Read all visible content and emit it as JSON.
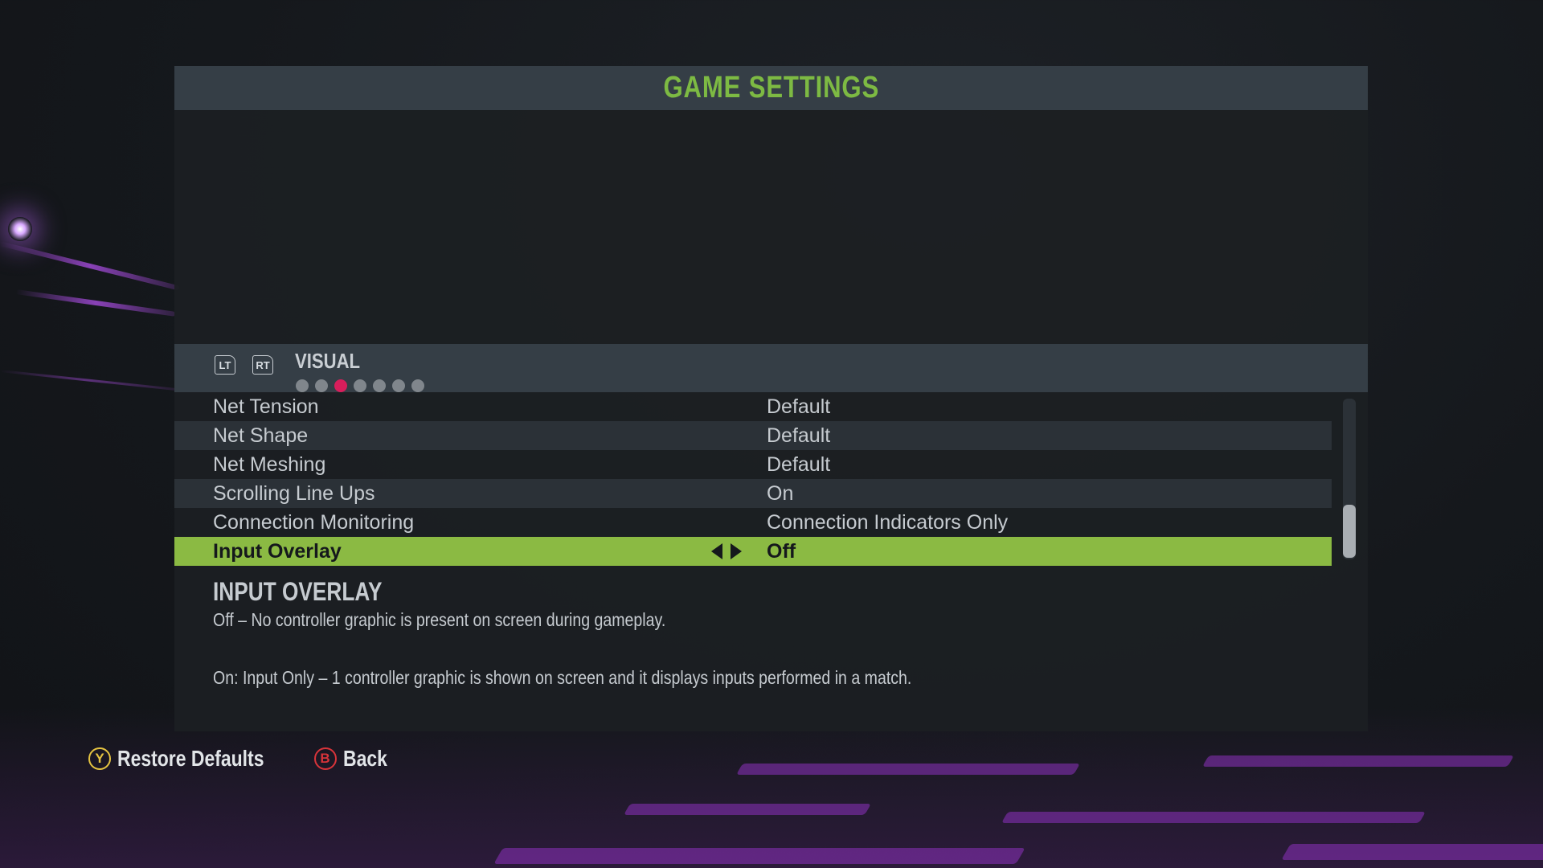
{
  "header": {
    "title": "GAME SETTINGS"
  },
  "tabs": {
    "lt_label": "LT",
    "rt_label": "RT",
    "current_tab": "VISUAL",
    "page_count": 7,
    "active_page": 3
  },
  "settings": [
    {
      "label": "Net Tension",
      "value": "Default"
    },
    {
      "label": "Net Shape",
      "value": "Default"
    },
    {
      "label": "Net Meshing",
      "value": "Default"
    },
    {
      "label": "Scrolling Line Ups",
      "value": "On"
    },
    {
      "label": "Connection Monitoring",
      "value": "Connection Indicators Only"
    },
    {
      "label": "Input Overlay",
      "value": "Off"
    }
  ],
  "description": {
    "title": "INPUT OVERLAY",
    "line1": "Off – No controller graphic is present on screen during gameplay.",
    "line2": "On: Input Only – 1 controller graphic is shown on screen and it displays inputs performed in a match."
  },
  "footer": {
    "restore_glyph": "Y",
    "restore_label": "Restore Defaults",
    "back_glyph": "B",
    "back_label": "Back"
  },
  "colors": {
    "accent_green": "#8bba43",
    "title_green": "#7dba43",
    "active_dot": "#d81e5b",
    "y_button": "#e5c341",
    "b_button": "#d8343a"
  }
}
